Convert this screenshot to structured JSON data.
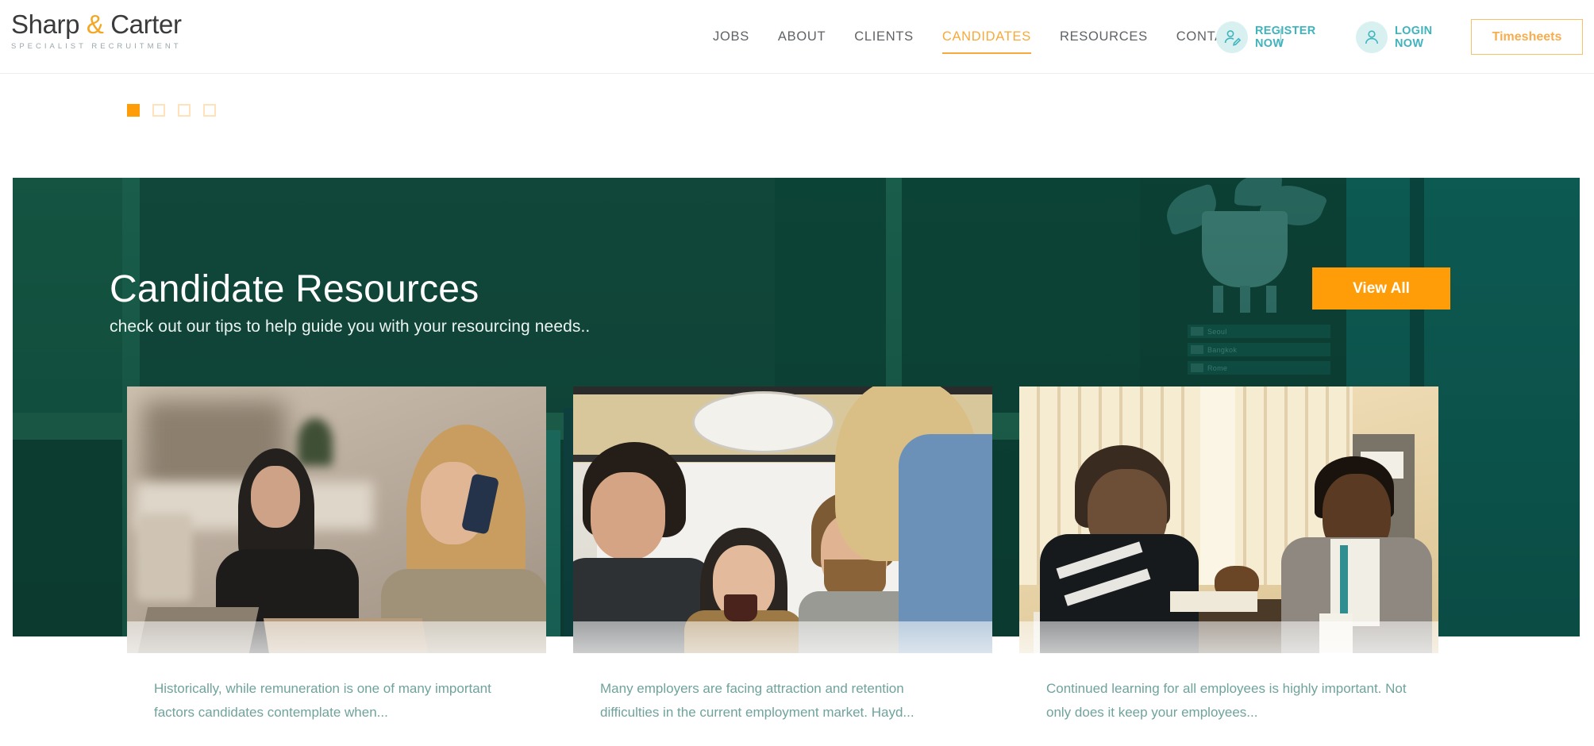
{
  "brand": {
    "name_part1": "Sharp",
    "amp": "&",
    "name_part2": "Carter",
    "tagline": "SPECIALIST RECRUITMENT"
  },
  "nav": {
    "items": [
      {
        "label": "JOBS",
        "active": false
      },
      {
        "label": "ABOUT",
        "active": false
      },
      {
        "label": "CLIENTS",
        "active": false
      },
      {
        "label": "CANDIDATES",
        "active": true
      },
      {
        "label": "RESOURCES",
        "active": false
      },
      {
        "label": "CONTACT",
        "active": false
      }
    ],
    "register": {
      "line1": "REGISTER",
      "line2": "NOW",
      "icon": "user-edit-icon"
    },
    "login": {
      "line1": "LOGIN",
      "line2": "NOW",
      "icon": "user-icon"
    },
    "timesheets_label": "Timesheets"
  },
  "carousel": {
    "dots": [
      {
        "active": true
      },
      {
        "active": false
      },
      {
        "active": false
      },
      {
        "active": false
      }
    ]
  },
  "hero": {
    "title": "Candidate Resources",
    "subtitle": "check out our tips to help guide you with your resourcing needs..",
    "view_all_label": "View All",
    "shelf_cards": [
      "Seoul",
      "Bangkok",
      "Rome"
    ]
  },
  "cards": [
    {
      "excerpt": "Historically, while remuneration is one of many important factors candidates contemplate when...",
      "image_alt": "two-women-working-laptops-phone-call"
    },
    {
      "excerpt": "Many employers are facing attraction and retention difficulties in the current employment market. Hayd...",
      "image_alt": "team-collaborating-around-table"
    },
    {
      "excerpt": "Continued learning for all employees is highly important. Not only does it keep your employees...",
      "image_alt": "two-men-in-discussion-at-desk"
    }
  ],
  "colors": {
    "accent_orange": "#ff9d08",
    "accent_orange_soft": "#f7a93b",
    "teal": "#3fb4bd",
    "hero_green": "#0f4235",
    "excerpt_text": "#6fa39c"
  }
}
